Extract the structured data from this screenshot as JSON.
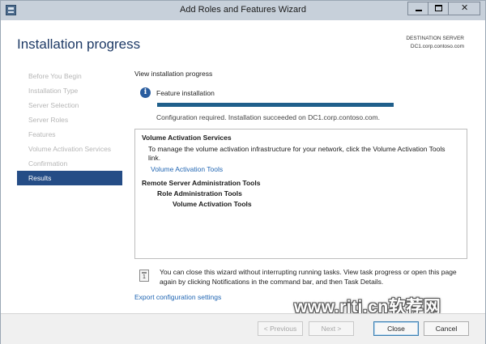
{
  "window": {
    "title": "Add Roles and Features Wizard",
    "minimize_glyph": "",
    "maximize_glyph": "",
    "close_glyph": "✕"
  },
  "header": {
    "page_title": "Installation progress",
    "destination_label": "DESTINATION SERVER",
    "destination_server": "DC1.corp.contoso.com"
  },
  "sidebar": {
    "items": [
      {
        "label": "Before You Begin",
        "state": "disabled"
      },
      {
        "label": "Installation Type",
        "state": "disabled"
      },
      {
        "label": "Server Selection",
        "state": "disabled"
      },
      {
        "label": "Server Roles",
        "state": "disabled"
      },
      {
        "label": "Features",
        "state": "disabled"
      },
      {
        "label": "Volume Activation Services",
        "state": "disabled"
      },
      {
        "label": "Confirmation",
        "state": "disabled"
      },
      {
        "label": "Results",
        "state": "active"
      }
    ]
  },
  "main": {
    "section_heading": "View installation progress",
    "feature_label": "Feature installation",
    "progress": 1.0,
    "status_text": "Configuration required. Installation succeeded on DC1.corp.contoso.com.",
    "results": {
      "group1_title": "Volume Activation Services",
      "group1_desc": "To manage the volume activation infrastructure for your network, click the Volume Activation Tools link.",
      "group1_link": "Volume Activation Tools",
      "group2_title": "Remote Server Administration Tools",
      "group2_sub1": "Role Administration Tools",
      "group2_sub2": "Volume Activation Tools"
    },
    "note_text": "You can close this wizard without interrupting running tasks. View task progress or open this page again by clicking Notifications in the command bar, and then Task Details.",
    "export_link": "Export configuration settings"
  },
  "footer": {
    "previous_label": "< Previous",
    "next_label": "Next >",
    "close_label": "Close",
    "cancel_label": "Cancel"
  },
  "watermark": "www.rjtj.cn软荐网",
  "colors": {
    "accent": "#254d86",
    "title_blue": "#1e3a66",
    "link": "#2166b3",
    "progress": "#1f5f8b"
  },
  "icons": {
    "info": "info-icon",
    "note": "notification-flag-icon",
    "app": "server-manager-icon"
  }
}
